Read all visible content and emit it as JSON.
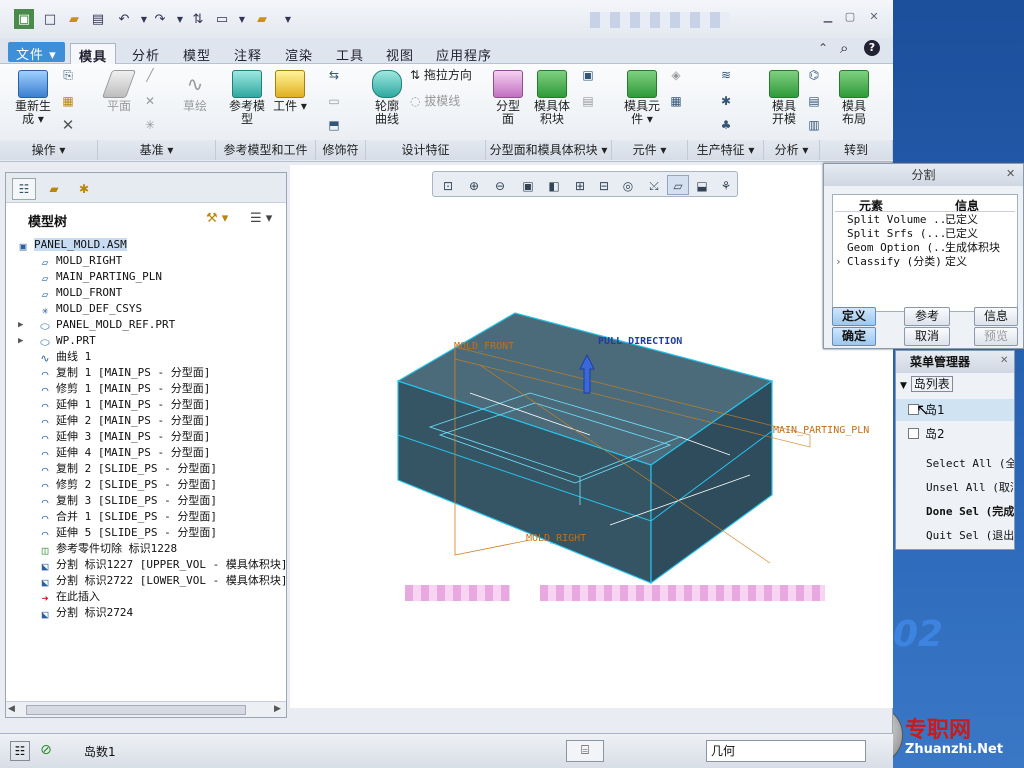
{
  "ribbon": {
    "tabs": [
      {
        "label": "文件",
        "type": "file"
      },
      {
        "label": "模具",
        "type": "active"
      },
      {
        "label": "分析"
      },
      {
        "label": "模型"
      },
      {
        "label": "注释"
      },
      {
        "label": "渲染"
      },
      {
        "label": "工具"
      },
      {
        "label": "视图"
      },
      {
        "label": "应用程序"
      }
    ],
    "buttons": {
      "regen": "重新生\n成",
      "plane": "平面",
      "sketch": "草绘",
      "ref_model": "参考模\n型",
      "workpiece": "工件",
      "contour_curve": "轮廓\n曲线",
      "drag_direction": "拖拉方向",
      "draft_line": "拔模线",
      "parting_surface": "分型\n面",
      "mold_volume": "模具体\n积块",
      "mold_component": "模具元\n件",
      "mold_open": "模具\n开模",
      "mold_layout": "模具\n布局"
    },
    "groups": [
      "操作",
      "基准",
      "参考模型和工件",
      "修饰符",
      "设计特征",
      "分型面和模具体积块",
      "元件",
      "生产特征",
      "分析",
      "转到"
    ]
  },
  "tree": {
    "header": "模型树",
    "rows": [
      {
        "text": "PANEL_MOLD.ASM",
        "icon": "assembly-icon",
        "indent": 0
      },
      {
        "text": "MOLD_RIGHT",
        "icon": "datum-plane-icon",
        "indent": 1
      },
      {
        "text": "MAIN_PARTING_PLN",
        "icon": "datum-plane-icon",
        "indent": 1
      },
      {
        "text": "MOLD_FRONT",
        "icon": "datum-plane-icon",
        "indent": 1
      },
      {
        "text": "MOLD_DEF_CSYS",
        "icon": "csys-icon",
        "indent": 1
      },
      {
        "text": "PANEL_MOLD_REF.PRT",
        "icon": "part-icon",
        "indent": 1,
        "expandable": true
      },
      {
        "text": "WP.PRT",
        "icon": "part-icon",
        "indent": 1,
        "expandable": true
      },
      {
        "text": "曲线 1",
        "icon": "curve-icon",
        "indent": 1
      },
      {
        "text": "复制 1 [MAIN_PS - 分型面]",
        "icon": "surface-icon",
        "indent": 1
      },
      {
        "text": "修剪 1 [MAIN_PS - 分型面]",
        "icon": "surface-icon",
        "indent": 1
      },
      {
        "text": "延伸 1 [MAIN_PS - 分型面]",
        "icon": "surface-icon",
        "indent": 1
      },
      {
        "text": "延伸 2 [MAIN_PS - 分型面]",
        "icon": "surface-icon",
        "indent": 1
      },
      {
        "text": "延伸 3 [MAIN_PS - 分型面]",
        "icon": "surface-icon",
        "indent": 1
      },
      {
        "text": "延伸 4 [MAIN_PS - 分型面]",
        "icon": "surface-icon",
        "indent": 1
      },
      {
        "text": "复制 2 [SLIDE_PS - 分型面]",
        "icon": "surface-icon",
        "indent": 1
      },
      {
        "text": "修剪 2 [SLIDE_PS - 分型面]",
        "icon": "surface-icon",
        "indent": 1
      },
      {
        "text": "复制 3 [SLIDE_PS - 分型面]",
        "icon": "surface-icon",
        "indent": 1
      },
      {
        "text": "合并 1 [SLIDE_PS - 分型面]",
        "icon": "surface-icon",
        "indent": 1
      },
      {
        "text": "延伸 5 [SLIDE_PS - 分型面]",
        "icon": "surface-icon",
        "indent": 1
      },
      {
        "text": "参考零件切除 标识1228",
        "icon": "cut-icon",
        "indent": 1
      },
      {
        "text": "分割 标识1227 [UPPER_VOL - 模具体积块]",
        "icon": "split-icon",
        "indent": 1
      },
      {
        "text": "分割 标识2722 [LOWER_VOL - 模具体积块]",
        "icon": "split-icon",
        "indent": 1
      },
      {
        "text": "在此插入",
        "icon": "insert-arrow-icon",
        "indent": 1
      },
      {
        "text": "分割 标识2724",
        "icon": "split-icon",
        "indent": 1
      }
    ]
  },
  "viewport": {
    "labels": {
      "pull_direction": "PULL DIRECTION",
      "mold_front": "MOLD_FRONT",
      "main_parting": "MAIN_PARTING_PLN",
      "mold_right": "MOLD_RIGHT"
    }
  },
  "split_dialog": {
    "title": "分割",
    "col_element": "元素",
    "col_info": "信息",
    "rows": [
      {
        "element": "Split Volume ...",
        "info": "已定义"
      },
      {
        "element": "Split Srfs (...",
        "info": "已定义"
      },
      {
        "element": "Geom Option (...",
        "info": "生成体积块"
      },
      {
        "element": "Classify (分类)",
        "info": "定义"
      }
    ],
    "buttons": {
      "define": "定义",
      "refs": "参考",
      "info": "信息",
      "ok": "确定",
      "cancel": "取消",
      "preview": "预览"
    }
  },
  "menu_manager": {
    "title": "菜单管理器",
    "section": "岛列表",
    "islands": [
      "岛1",
      "岛2"
    ],
    "items": [
      "Select All (全选",
      "Unsel All (取消",
      "Done Sel (完成",
      "Quit Sel (退出"
    ]
  },
  "status": {
    "message": "岛数1",
    "filter": "几何"
  },
  "desktop": {
    "brand_cn": "专职网",
    "brand_url": "Zhuanzhi.Net",
    "deco": "02"
  },
  "colors": {
    "accent": "#3f8ed8",
    "mold_body": "#3f5f6f",
    "mold_edge": "#20c0e8",
    "datum": "#d08020"
  }
}
